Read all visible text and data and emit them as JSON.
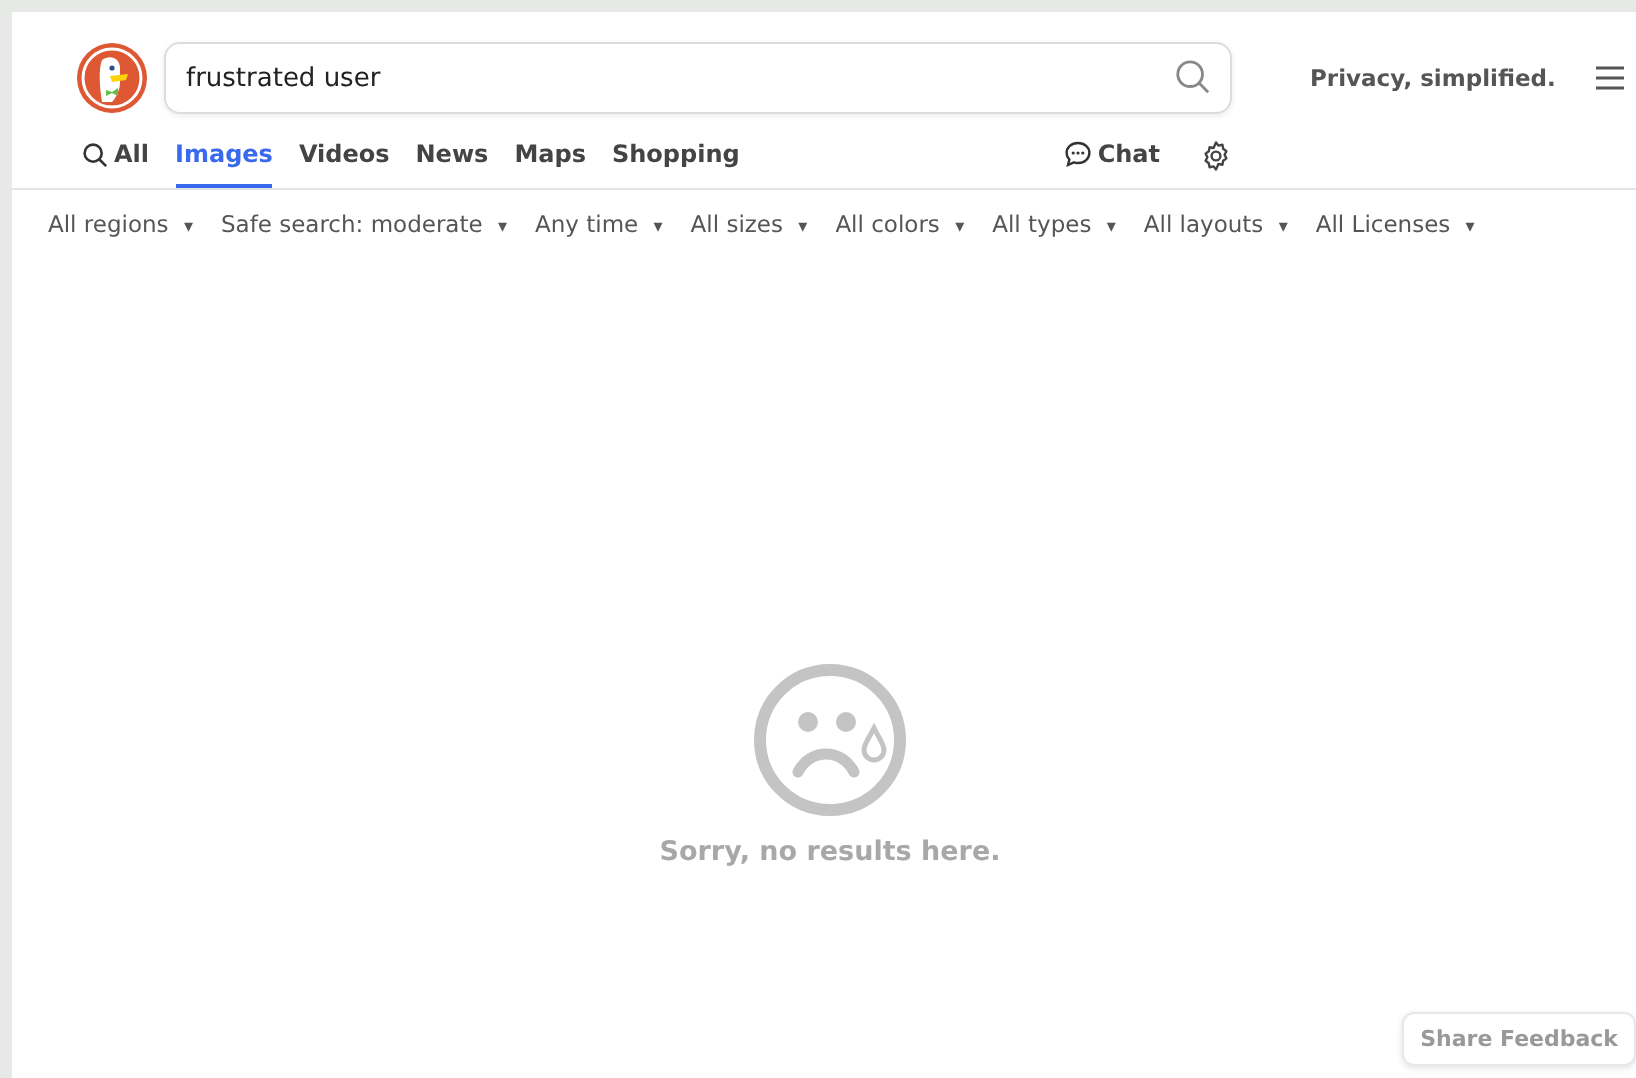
{
  "search": {
    "value": "frustrated user"
  },
  "tagline": "Privacy, simplified.",
  "tabs": [
    {
      "label": "All",
      "kind": "search",
      "selected": false
    },
    {
      "label": "Images",
      "selected": true
    },
    {
      "label": "Videos",
      "selected": false
    },
    {
      "label": "News",
      "selected": false
    },
    {
      "label": "Maps",
      "selected": false
    },
    {
      "label": "Shopping",
      "selected": false
    }
  ],
  "chat": "Chat",
  "filters": [
    "All regions",
    "Safe search: moderate",
    "Any time",
    "All sizes",
    "All colors",
    "All types",
    "All layouts",
    "All Licenses"
  ],
  "filter_caret": "▾",
  "empty_message": "Sorry, no results here.",
  "feedback_button": "Share Feedback"
}
